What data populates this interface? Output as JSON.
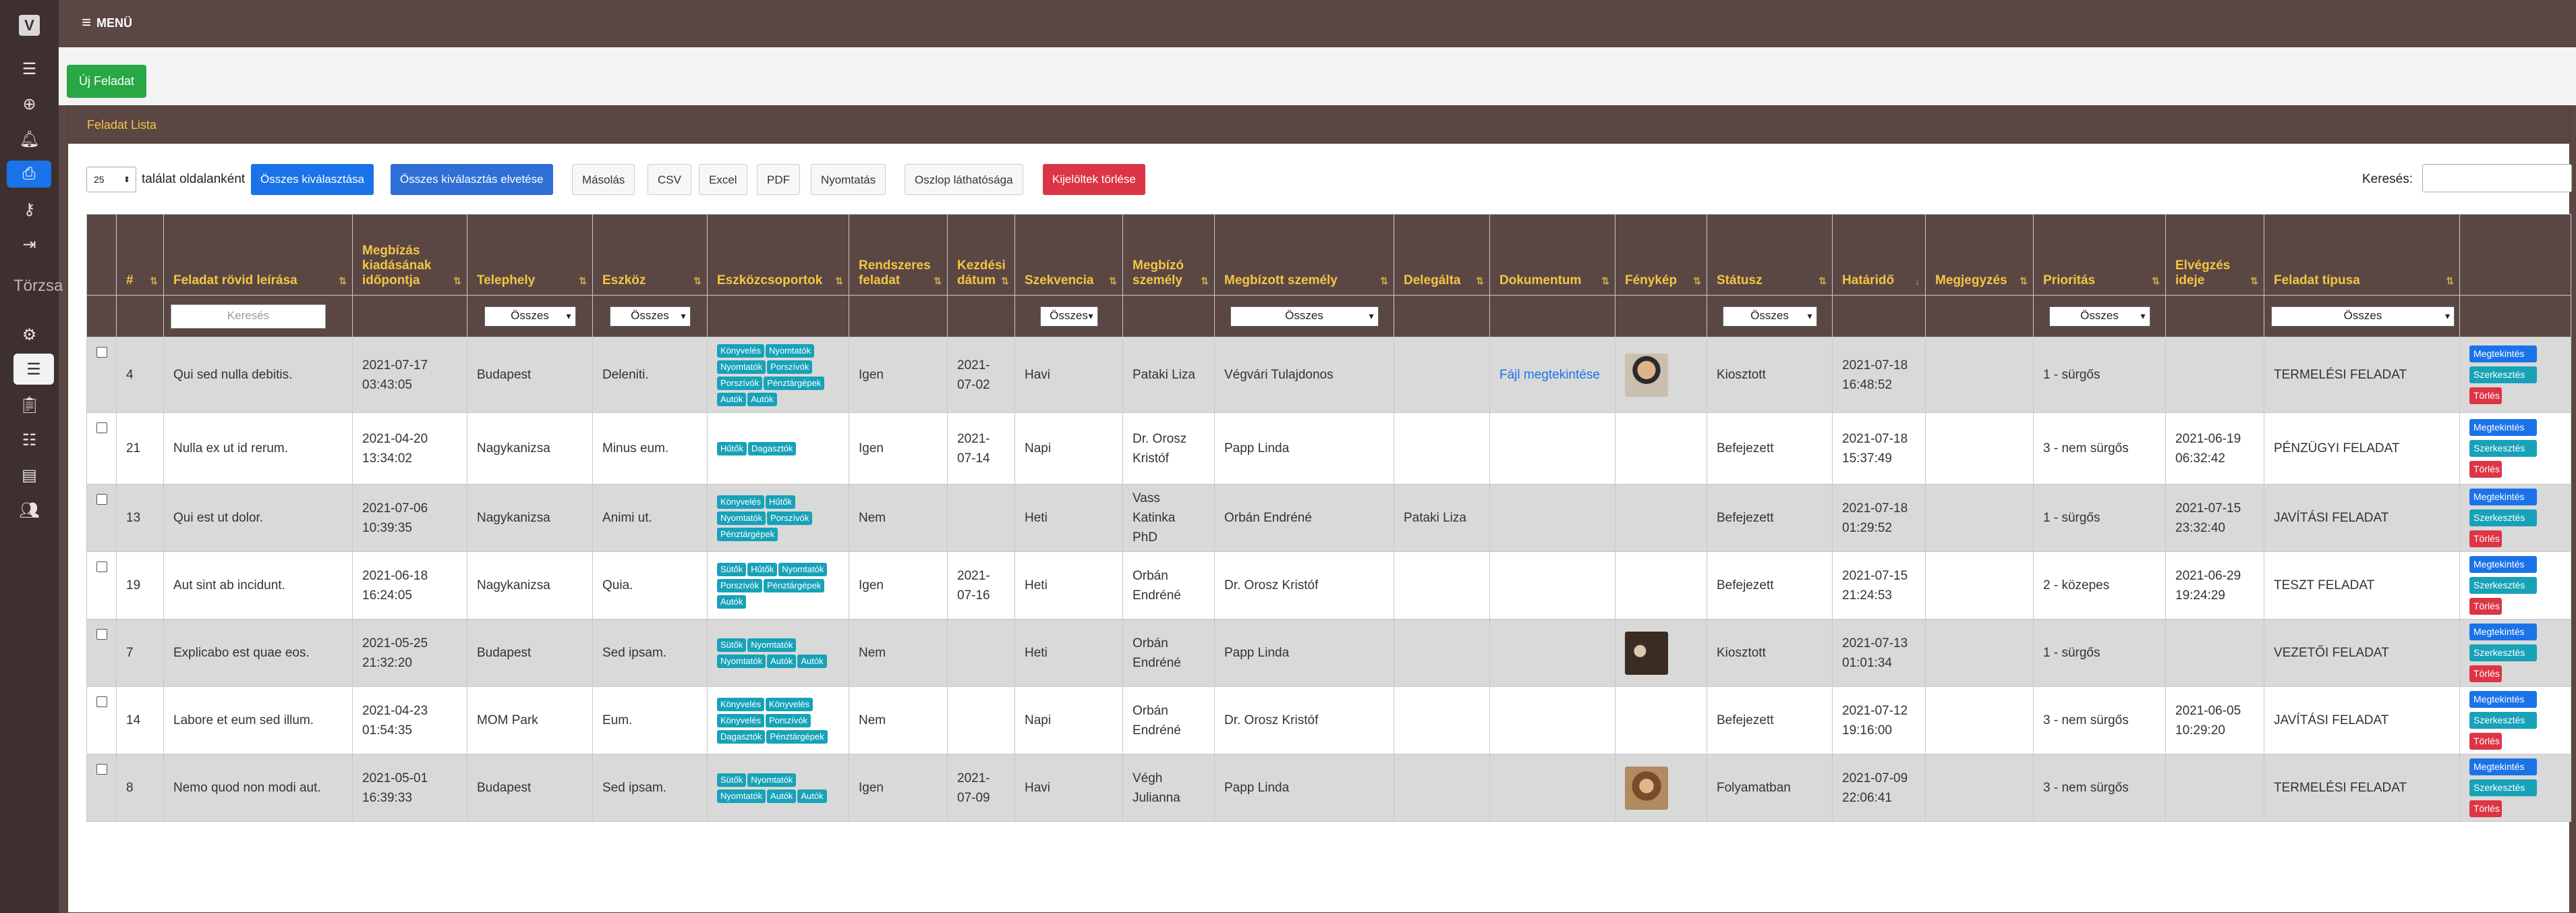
{
  "app": {
    "logo_letter": "V"
  },
  "sidebar": {
    "section_label": "Törzsa",
    "icons": [
      "list-icon",
      "plus-circle-icon",
      "bell-icon",
      "printer-icon",
      "key-icon",
      "sign-out-icon",
      "gears-icon",
      "list-icon",
      "clipboard-icon",
      "server-icon",
      "book-icon",
      "users-icon"
    ]
  },
  "topbar": {
    "menu_label": "MENÜ",
    "menu_icon": "≡"
  },
  "toolbar": {
    "new_task": "Új Feladat",
    "panel_title": "Feladat Lista",
    "page_length": "25",
    "page_length_label": "találat oldalanként",
    "select_all": "Összes kiválasztása",
    "deselect_all": "Összes kiválasztás elvetése",
    "copy": "Másolás",
    "csv": "CSV",
    "excel": "Excel",
    "pdf": "PDF",
    "print": "Nyomtatás",
    "col_visibility": "Oszlop láthatósága",
    "delete_selected": "Kijelöltek törlése",
    "search_label": "Keresés:"
  },
  "table": {
    "columns": [
      "",
      "#",
      "Feladat rövid leírása",
      "Megbízás kiadásának időpontja",
      "Telephely",
      "Eszköz",
      "Eszközcsoportok",
      "Rendszeres feladat",
      "Kezdési dátum",
      "Szekvencia",
      "Megbízó személy",
      "Megbízott személy",
      "Delegálta",
      "Dokumentum",
      "Fénykép",
      "Státusz",
      "Határidő",
      "Megjegyzés",
      "Prioritás",
      "Elvégzés ideje",
      "Feladat típusa",
      ""
    ],
    "filters": {
      "search_placeholder": "Keresés",
      "all": "Összes"
    },
    "rows": [
      {
        "id": "4",
        "desc": "Qui sed nulla debitis.",
        "issued": "2021-07-17\n03:43:05",
        "site": "Budapest",
        "tool": "Deleniti.",
        "groups": [
          "Könyvelés",
          "Nyomtatók",
          "Nyomtatók",
          "Porszívók",
          "Porszívók",
          "Pénztárgépek",
          "Autók",
          "Autók"
        ],
        "regular": "Igen",
        "start": "2021-07-02",
        "seq": "Havi",
        "giver": "Pataki Liza",
        "assignee": "Végvári Tulajdonos",
        "delegated": "",
        "doc": "Fájl megtekintése",
        "photo": "photo-person",
        "status": "Kiosztott",
        "deadline": "2021-07-18\n16:48:52",
        "note": "",
        "priority": "1 - sürgős",
        "done": "",
        "type": "TERMELÉSI FELADAT"
      },
      {
        "id": "21",
        "desc": "Nulla ex ut id rerum.",
        "issued": "2021-04-20\n13:34:02",
        "site": "Nagykanizsa",
        "tool": "Minus eum.",
        "groups": [
          "Hűtők",
          "Dagasztók"
        ],
        "regular": "Igen",
        "start": "2021-07-14",
        "seq": "Napi",
        "giver": "Dr. Orosz\nKristóf",
        "assignee": "Papp Linda",
        "delegated": "",
        "doc": "",
        "photo": "",
        "status": "Befejezett",
        "deadline": "2021-07-18\n15:37:49",
        "note": "",
        "priority": "3 - nem sürgős",
        "done": "2021-06-19\n06:32:42",
        "type": "PÉNZÜGYI FELADAT"
      },
      {
        "id": "13",
        "desc": "Qui est ut dolor.",
        "issued": "2021-07-06\n10:39:35",
        "site": "Nagykanizsa",
        "tool": "Animi ut.",
        "groups": [
          "Könyvelés",
          "Hűtők",
          "Nyomtatók",
          "Porszívók",
          "Pénztárgépek"
        ],
        "regular": "Nem",
        "start": "",
        "seq": "Heti",
        "giver": "Vass Katinka\nPhD",
        "assignee": "Orbán Endréné",
        "delegated": "Pataki Liza",
        "doc": "",
        "photo": "",
        "status": "Befejezett",
        "deadline": "2021-07-18\n01:29:52",
        "note": "",
        "priority": "1 - sürgős",
        "done": "2021-07-15\n23:32:40",
        "type": "JAVÍTÁSI FELADAT"
      },
      {
        "id": "19",
        "desc": "Aut sint ab incidunt.",
        "issued": "2021-06-18\n16:24:05",
        "site": "Nagykanizsa",
        "tool": "Quia.",
        "groups": [
          "Sütők",
          "Hűtők",
          "Nyomtatók",
          "Porszívók",
          "Pénztárgépek",
          "Autók"
        ],
        "regular": "Igen",
        "start": "2021-07-16",
        "seq": "Heti",
        "giver": "Orbán\nEndréné",
        "assignee": "Dr. Orosz Kristóf",
        "delegated": "",
        "doc": "",
        "photo": "",
        "status": "Befejezett",
        "deadline": "2021-07-15\n21:24:53",
        "note": "",
        "priority": "2 - közepes",
        "done": "2021-06-29\n19:24:29",
        "type": "TESZT FELADAT"
      },
      {
        "id": "7",
        "desc": "Explicabo est quae eos.",
        "issued": "2021-05-25\n21:32:20",
        "site": "Budapest",
        "tool": "Sed ipsam.",
        "groups": [
          "Sütők",
          "Nyomtatók",
          "Nyomtatók",
          "Autók",
          "Autók"
        ],
        "regular": "Nem",
        "start": "",
        "seq": "Heti",
        "giver": "Orbán\nEndréné",
        "assignee": "Papp Linda",
        "delegated": "",
        "doc": "",
        "photo": "photo-dark",
        "status": "Kiosztott",
        "deadline": "2021-07-13\n01:01:34",
        "note": "",
        "priority": "1 - sürgős",
        "done": "",
        "type": "VEZETŐI FELADAT"
      },
      {
        "id": "14",
        "desc": "Labore et eum sed illum.",
        "issued": "2021-04-23\n01:54:35",
        "site": "MOM Park",
        "tool": "Eum.",
        "groups": [
          "Könyvelés",
          "Könyvelés",
          "Könyvelés",
          "Porszívók",
          "Dagasztók",
          "Pénztárgépek"
        ],
        "regular": "Nem",
        "start": "",
        "seq": "Napi",
        "giver": "Orbán\nEndréné",
        "assignee": "Dr. Orosz Kristóf",
        "delegated": "",
        "doc": "",
        "photo": "",
        "status": "Befejezett",
        "deadline": "2021-07-12\n19:16:00",
        "note": "",
        "priority": "3 - nem sürgős",
        "done": "2021-06-05\n10:29:20",
        "type": "JAVÍTÁSI FELADAT"
      },
      {
        "id": "8",
        "desc": "Nemo quod non modi aut.",
        "issued": "2021-05-01\n16:39:33",
        "site": "Budapest",
        "tool": "Sed ipsam.",
        "groups": [
          "Sütők",
          "Nyomtatók",
          "Nyomtatók",
          "Autók",
          "Autók"
        ],
        "regular": "Igen",
        "start": "2021-07-09",
        "seq": "Havi",
        "giver": "Végh\nJulianna",
        "assignee": "Papp Linda",
        "delegated": "",
        "doc": "",
        "photo": "photo-warm",
        "status": "Folyamatban",
        "deadline": "2021-07-09\n22:06:41",
        "note": "",
        "priority": "3 - nem sürgős",
        "done": "",
        "type": "TERMELÉSI FELADAT"
      }
    ],
    "actions": {
      "view": "Megtekintés",
      "edit": "Szerkesztés",
      "delete": "Törlés"
    }
  },
  "colors": {
    "accent": "#1a73e8",
    "header_bg": "#5a4744",
    "header_text": "#f5c542",
    "success": "#28a745",
    "danger": "#dc3545",
    "badge": "#17a2b8"
  }
}
